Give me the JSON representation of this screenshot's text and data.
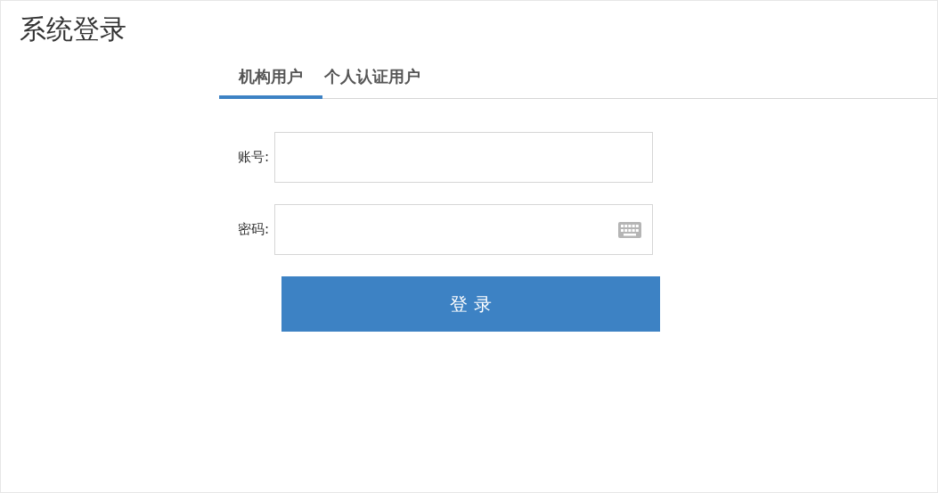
{
  "title": "系统登录",
  "tabs": [
    {
      "label": "机构用户",
      "selected": true
    },
    {
      "label": "个人认证用户",
      "selected": false
    }
  ],
  "fields": [
    {
      "label": "账号:",
      "kind": "text"
    },
    {
      "label": "密码:",
      "kind": "password"
    }
  ],
  "submit": "登 录"
}
